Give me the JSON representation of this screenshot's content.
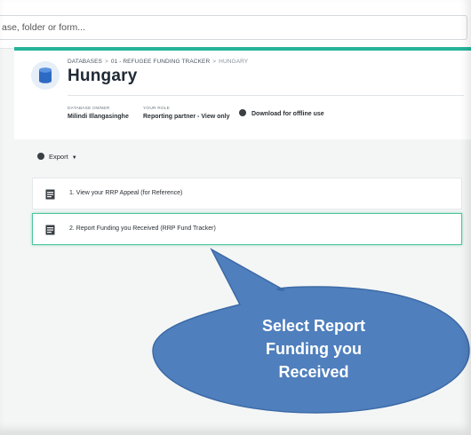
{
  "search": {
    "value": "ase, folder or form..."
  },
  "breadcrumb": {
    "databases": "DATABASES",
    "separator": ">",
    "tracker": "01 - REFUGEE FUNDING TRACKER",
    "current": "HUNGARY"
  },
  "page": {
    "title": "Hungary",
    "icon": "database-icon"
  },
  "meta": {
    "owner_label": "DATABASE OWNER",
    "owner_value": "Milindi Illangasinghe",
    "role_label": "YOUR ROLE",
    "role_value": "Reporting partner - View only",
    "download_label": "Download for offline use",
    "download_icon": "download-icon"
  },
  "export": {
    "label": "Export",
    "icon": "export-icon",
    "caret": "▼"
  },
  "forms": [
    {
      "label": "1. View your RRP Appeal (for Reference)",
      "icon": "form-icon",
      "selected": false
    },
    {
      "label": "2. Report Funding you Received (RRP Fund Tracker)",
      "icon": "form-icon",
      "selected": true
    }
  ],
  "callout": {
    "line1": "Select Report",
    "line2": "Funding you",
    "line3": "Received"
  },
  "colors": {
    "accent": "#26b39a",
    "selected_border": "#4cc59a",
    "callout_fill": "#4f7fbd",
    "callout_stroke": "#3c6aa6"
  }
}
